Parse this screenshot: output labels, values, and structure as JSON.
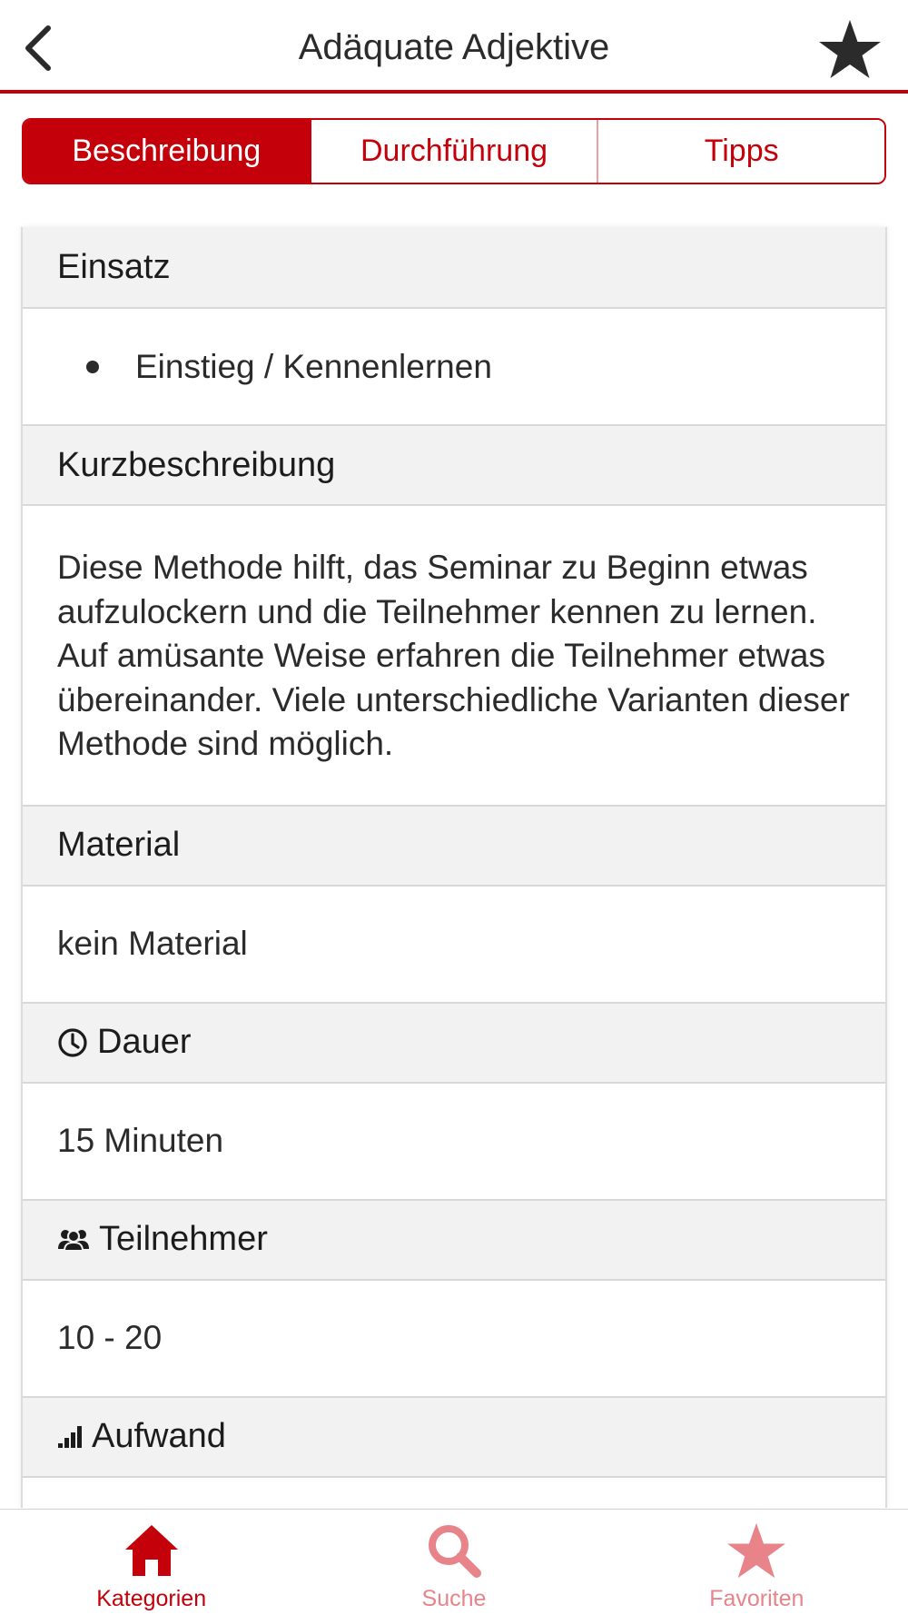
{
  "header": {
    "title": "Adäquate Adjektive",
    "back_icon": "chevron-left-icon",
    "favorite_icon": "star-icon"
  },
  "segments": [
    {
      "label": "Beschreibung",
      "active": true
    },
    {
      "label": "Durchführung",
      "active": false
    },
    {
      "label": "Tipps",
      "active": false
    }
  ],
  "sections": {
    "einsatz": {
      "title": "Einsatz",
      "items": [
        "Einstieg / Kennenlernen"
      ]
    },
    "kurzbeschreibung": {
      "title": "Kurzbeschreibung",
      "text": "Diese Methode hilft, das Seminar zu Beginn etwas aufzulockern und die Teilnehmer kennen zu lernen. Auf amüsante Weise erfahren die Teilnehmer etwas übereinander. Viele unterschiedliche Varianten dieser Methode sind möglich."
    },
    "material": {
      "title": "Material",
      "value": "kein Material"
    },
    "dauer": {
      "title": "Dauer",
      "icon": "clock-icon",
      "value": "15 Minuten"
    },
    "teilnehmer": {
      "title": "Teilnehmer",
      "icon": "people-icon",
      "value": "10 - 20"
    },
    "aufwand": {
      "title": "Aufwand",
      "icon": "signal-bars-icon"
    }
  },
  "tabbar": {
    "tabs": [
      {
        "label": "Kategorien",
        "icon": "home-icon",
        "active": true
      },
      {
        "label": "Suche",
        "icon": "search-icon",
        "active": false
      },
      {
        "label": "Favoriten",
        "icon": "star-icon",
        "active": false
      }
    ]
  },
  "colors": {
    "accent": "#c4000a",
    "inactive_tab": "#e8838a",
    "section_header_bg": "#f2f2f2"
  }
}
